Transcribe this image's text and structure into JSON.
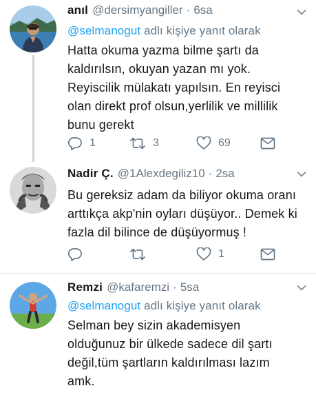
{
  "tweets": [
    {
      "name": "anıl",
      "handle": "@dersimyangiller",
      "dot": "·",
      "time": "6sa",
      "reply_mention": "@selmanogut",
      "reply_suffix": " adlı kişiye yanıt olarak",
      "lines": [
        "Hatta okuma yazma bilme şartı da",
        "kaldırılsın, okuyan yazan mı yok.",
        "Reyiscilik mülakatı yapılsın. En reyisci",
        "olan direkt prof olsun,yerlilik ve millilik",
        "bunu gerekt"
      ],
      "reply_count": "1",
      "retweet_count": "3",
      "like_count": "69"
    },
    {
      "name": "Nadir Ç.",
      "handle": "@1Alexdegiliz10",
      "dot": "·",
      "time": "2sa",
      "lines": [
        "Bu gereksiz adam da biliyor okuma oranı",
        "arttıkça akp'nin oyları düşüyor.. Demek ki",
        "fazla dil bilince de düşüyormuş !"
      ],
      "reply_count": "",
      "retweet_count": "",
      "like_count": "1"
    },
    {
      "name": "Remzi",
      "handle": "@kafaremzi",
      "dot": "·",
      "time": "5sa",
      "reply_mention": "@selmanogut",
      "reply_suffix": " adlı kişiye yanıt olarak",
      "lines": [
        "Selman bey sizin akademisyen",
        "olduğunuz bir ülkede sadece dil şartı",
        "değil,tüm şartların kaldırılması lazım",
        "amk."
      ]
    }
  ],
  "colors": {
    "text": "#14171a",
    "secondary": "#657786",
    "mention": "#1da1f2",
    "divider": "#e1e8ed",
    "thread_line": "#ccd6dd"
  },
  "icons": [
    "reply-icon",
    "retweet-icon",
    "like-icon",
    "direct-message-icon",
    "chevron-down-icon"
  ]
}
